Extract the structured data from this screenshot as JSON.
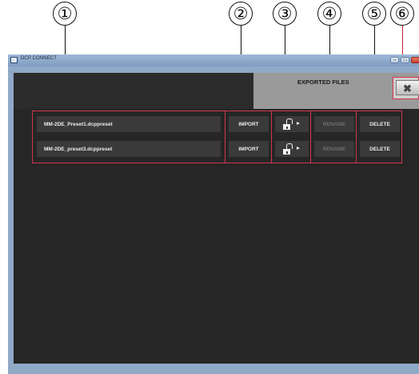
{
  "callouts": [
    "①",
    "②",
    "③",
    "④",
    "⑤",
    "⑥"
  ],
  "window": {
    "title": "DCP CONNECT",
    "controls": [
      "minimize",
      "maximize",
      "close"
    ]
  },
  "dialog": {
    "title": "EXPORTED FILES",
    "close_icon": "close-x-icon"
  },
  "files": [
    {
      "name": "MM-2DE_Preset1.dcppreset",
      "import_label": "IMPORT",
      "lock_icon": "unlock-icon",
      "rename_label": "RENAME",
      "rename_enabled": false,
      "delete_label": "DELETE"
    },
    {
      "name": "MM-2DE_preset3.dcppreset",
      "import_label": "IMPORT",
      "lock_icon": "unlock-icon",
      "rename_label": "RENAME",
      "rename_enabled": false,
      "delete_label": "DELETE"
    }
  ],
  "colors": {
    "highlight_red": "#d3364b",
    "dialog_bg": "#262626",
    "row_bg": "#3a3a3a",
    "text_light": "#ededed",
    "text_disabled": "#6e6e6e"
  }
}
